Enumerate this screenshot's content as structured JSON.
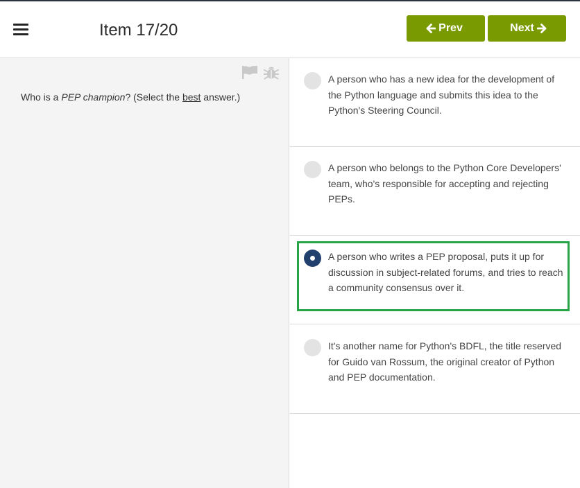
{
  "header": {
    "title": "Item 17/20",
    "prev_label": "Prev",
    "next_label": "Next",
    "button_color": "#7a9a01"
  },
  "icons": {
    "menu": "hamburger-menu-icon",
    "flag": "flag-icon",
    "bug": "bug-icon",
    "prev_arrow": "arrow-left-icon",
    "next_arrow": "arrow-right-icon"
  },
  "question": {
    "prefix": "Who is a ",
    "term": "PEP champion",
    "middle": "? (Select the ",
    "emphasis": "best",
    "suffix": " answer.)"
  },
  "options": [
    {
      "text": "A person who has a new idea for the development of the Python language and submits this idea to the Python's Steering Council.",
      "selected": false
    },
    {
      "text": "A person who belongs to the Python Core Developers' team, who's responsible for accepting and rejecting PEPs.",
      "selected": false
    },
    {
      "text": "A person who writes a PEP proposal, puts it up for discussion in subject-related forums, and tries to reach a community consensus over it.",
      "selected": true
    },
    {
      "text": "It's another name for Python's BDFL, the title reserved for Guido van Rossum, the original creator of Python and PEP documentation.",
      "selected": false
    }
  ],
  "colors": {
    "selected_radio": "#22406e",
    "selection_outline": "#27a546"
  }
}
